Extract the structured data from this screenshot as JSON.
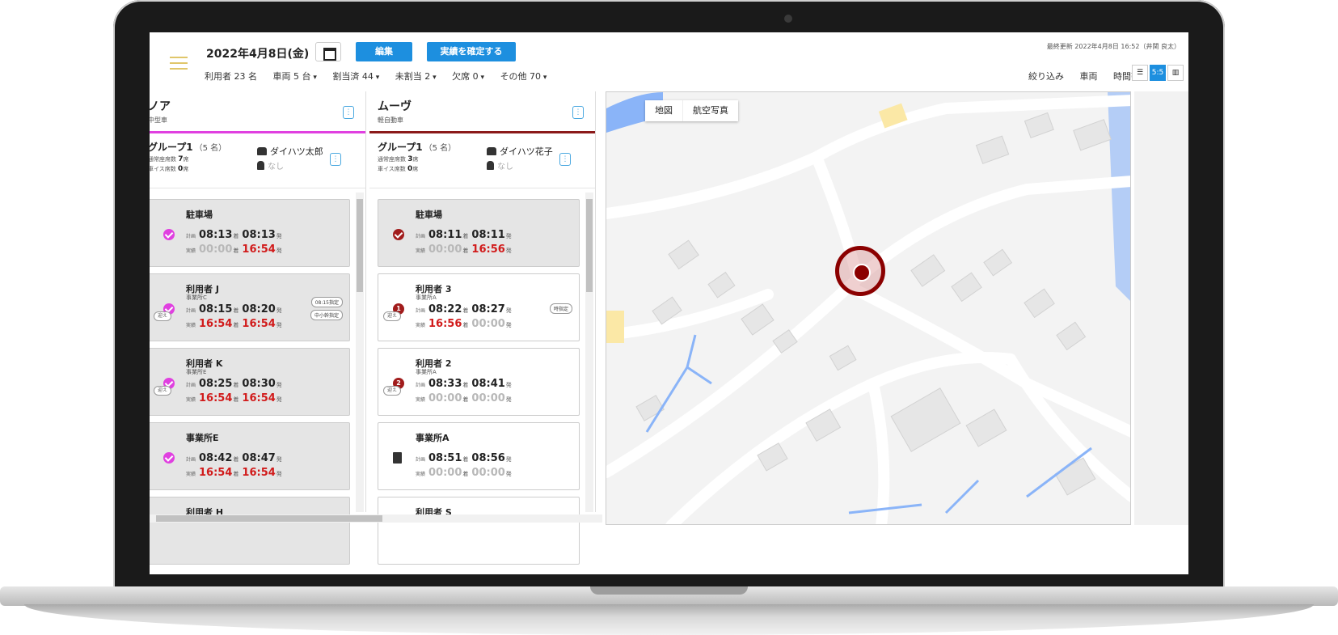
{
  "header": {
    "date_title": "2022年4月8日(金)",
    "edit_label": "編集",
    "confirm_label": "実績を確定する",
    "last_updated": "最終更新 2022年4月8日 16:52（井関 良太）"
  },
  "summary": {
    "users": "利用者 23 名",
    "vehicles": "車両 5 台",
    "assigned": "割当済 44",
    "unassigned": "未割当 2",
    "absent": "欠席 0",
    "other": "その他 70"
  },
  "filters": {
    "filter_label": "絞り込み",
    "vehicle_label": "車両",
    "time_label": "時間帯",
    "view_split_label": "5:5"
  },
  "columns": [
    {
      "name": "ノア",
      "type": "中型車",
      "group": {
        "title": "グループ1",
        "count": "（5 名）",
        "normal_seat_label": "通常座席数",
        "normal_seat_value": "7",
        "normal_seat_unit": "席",
        "wheel_seat_label": "車イス席数",
        "wheel_seat_value": "0",
        "wheel_seat_unit": "席",
        "driver": "ダイハツ太郎",
        "helper": "なし"
      },
      "cards": [
        {
          "name": "駐車場",
          "office": "",
          "plan_arr": "08:13",
          "plan_dep": "08:13",
          "act_arr": "00:00",
          "act_dep": "16:54",
          "pick": "",
          "tag1": "",
          "tag2": ""
        },
        {
          "name": "利用者 J",
          "office": "事業所C",
          "plan_arr": "08:15",
          "plan_dep": "08:20",
          "act_arr": "16:54",
          "act_dep": "16:54",
          "pick": "迎え",
          "tag1": "08:15指定",
          "tag2": "中小幹指定"
        },
        {
          "name": "利用者 K",
          "office": "事業所E",
          "plan_arr": "08:25",
          "plan_dep": "08:30",
          "act_arr": "16:54",
          "act_dep": "16:54",
          "pick": "迎え",
          "tag1": "",
          "tag2": ""
        },
        {
          "name": "事業所E",
          "office": "",
          "plan_arr": "08:42",
          "plan_dep": "08:47",
          "act_arr": "16:54",
          "act_dep": "16:54",
          "pick": "",
          "tag1": "",
          "tag2": ""
        },
        {
          "name": "利用者 H"
        }
      ]
    },
    {
      "name": "ムーヴ",
      "type": "軽自動車",
      "group": {
        "title": "グループ1",
        "count": "（5 名）",
        "normal_seat_label": "通常座席数",
        "normal_seat_value": "3",
        "normal_seat_unit": "席",
        "wheel_seat_label": "車イス席数",
        "wheel_seat_value": "0",
        "wheel_seat_unit": "席",
        "driver": "ダイハツ花子",
        "helper": "なし"
      },
      "cards": [
        {
          "name": "駐車場",
          "office": "",
          "plan_arr": "08:11",
          "plan_dep": "08:11",
          "act_arr": "00:00",
          "act_dep": "16:56",
          "pick": "",
          "tag1": "",
          "num": ""
        },
        {
          "name": "利用者 3",
          "office": "事業所A",
          "plan_arr": "08:22",
          "plan_dep": "08:27",
          "act_arr": "16:56",
          "act_dep": "00:00",
          "pick": "迎え",
          "tag1": "時指定",
          "num": "1"
        },
        {
          "name": "利用者 2",
          "office": "事業所A",
          "plan_arr": "08:33",
          "plan_dep": "08:41",
          "act_arr": "00:00",
          "act_dep": "00:00",
          "pick": "迎え",
          "tag1": "",
          "num": "2"
        },
        {
          "name": "事業所A",
          "office": "",
          "plan_arr": "08:51",
          "plan_dep": "08:56",
          "act_arr": "00:00",
          "act_dep": "00:00",
          "pick": "",
          "tag1": "",
          "num": ""
        },
        {
          "name": "利用者 S"
        }
      ]
    }
  ],
  "labels": {
    "plan": "計画",
    "actual": "実績",
    "arrive": "着",
    "depart": "発"
  },
  "map": {
    "tab_map": "地図",
    "tab_aerial": "航空写真"
  }
}
